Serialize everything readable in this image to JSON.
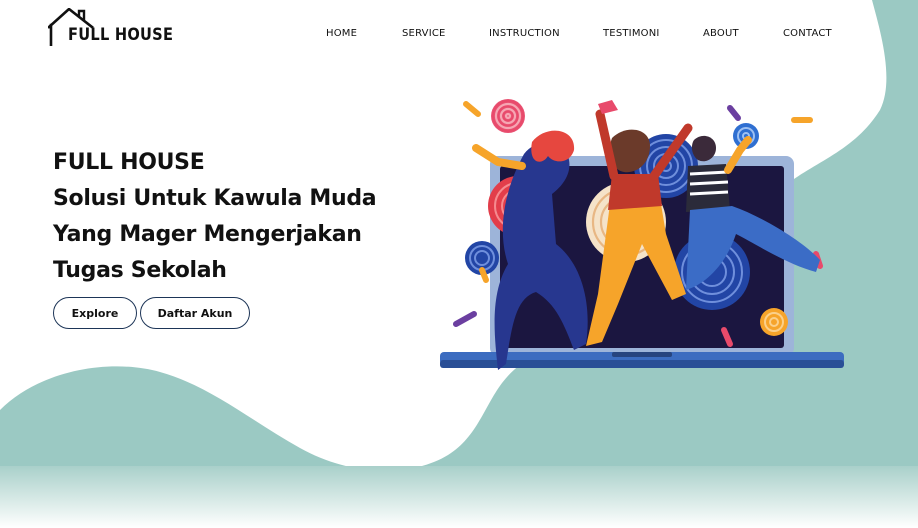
{
  "brand": {
    "name": "FULL HOUSE",
    "icon": "house-outline-icon"
  },
  "nav": {
    "items": [
      "HOME",
      "SERVICE",
      "INSTRUCTION",
      "TESTIMONI",
      "ABOUT",
      "CONTACT"
    ]
  },
  "hero": {
    "lines": [
      "FULL HOUSE",
      "Solusi Untuk Kawula Muda",
      "Yang Mager Mengerjakan",
      "Tugas Sekolah"
    ],
    "buttons": {
      "explore": "Explore",
      "register": "Daftar Akun"
    },
    "illustration": "people-celebrating-on-laptop-illustration"
  },
  "colors": {
    "teal": "#9bc9c3",
    "button_border": "#1d3557",
    "text": "#111111"
  }
}
